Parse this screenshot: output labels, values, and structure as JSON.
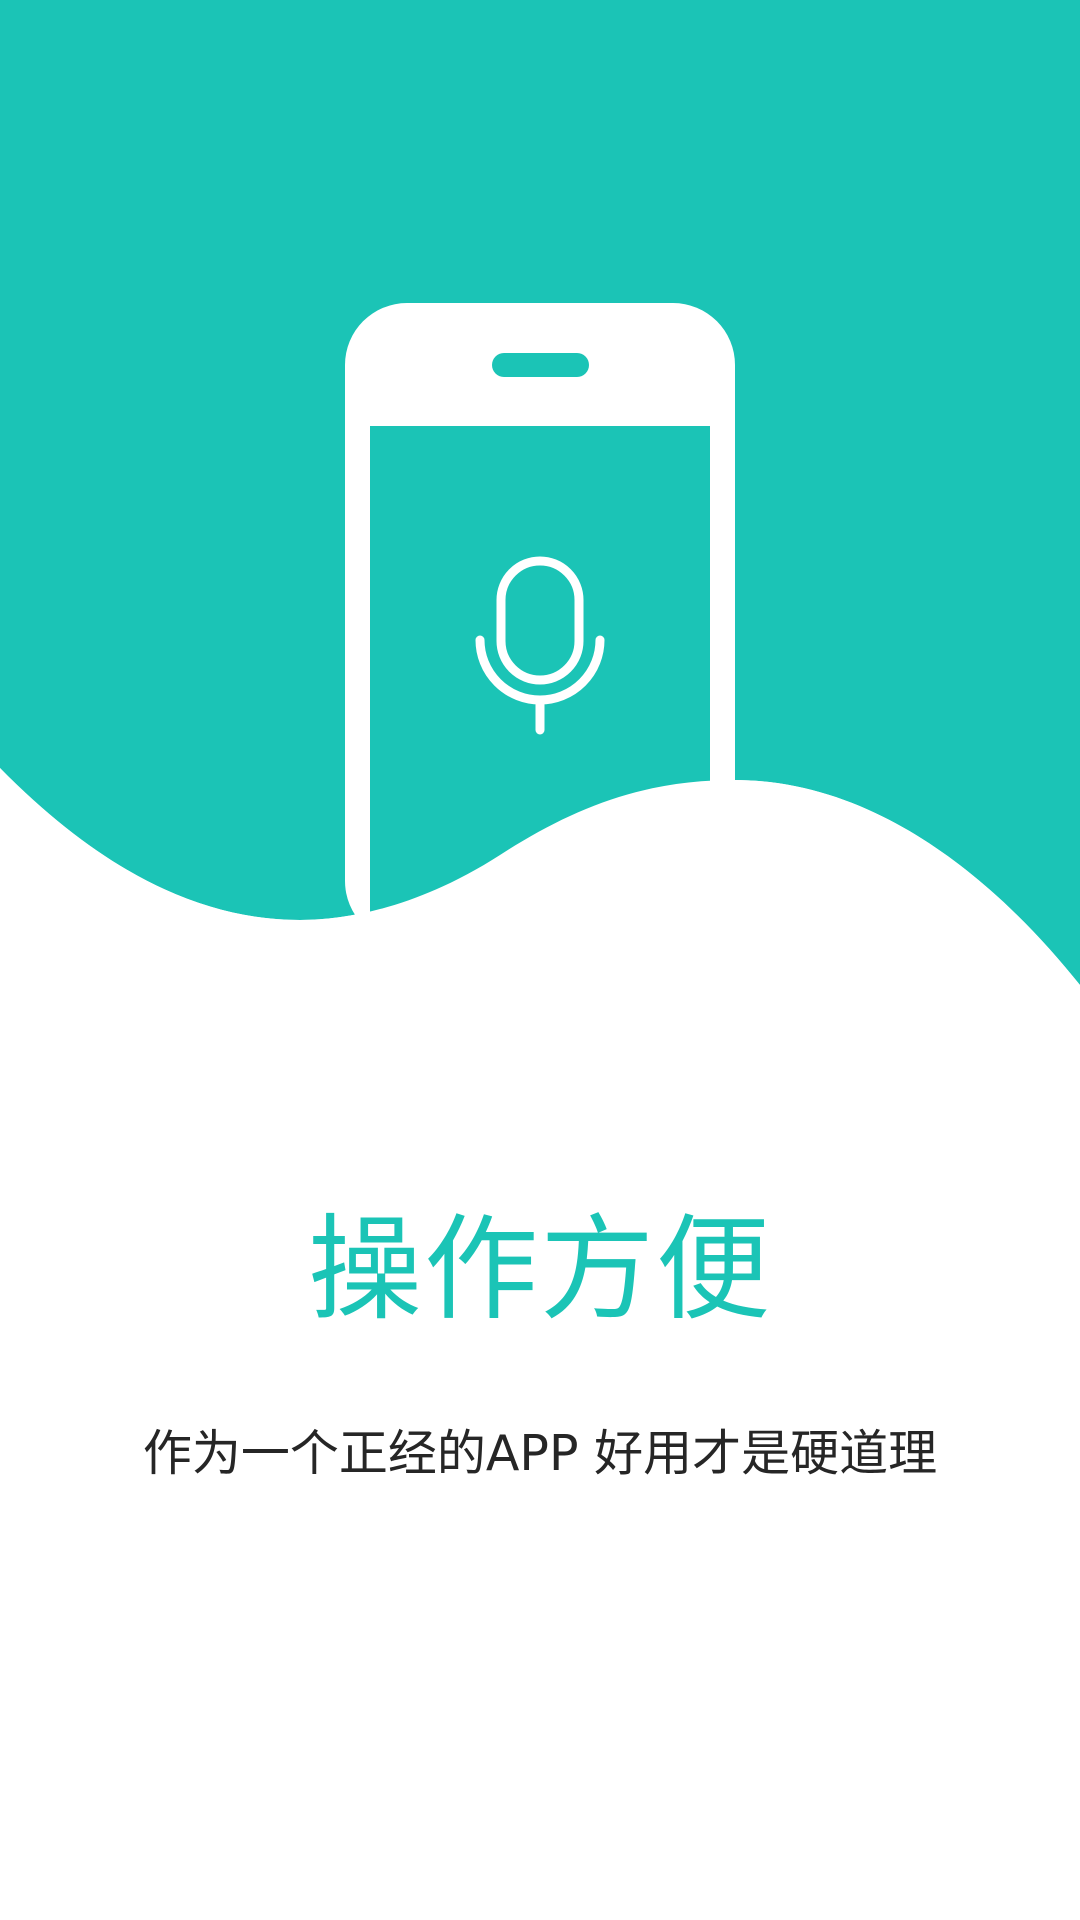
{
  "colors": {
    "accent": "#1BC4B6",
    "background": "#FFFFFF",
    "text": "#262626"
  },
  "illustration": {
    "icon_device": "smartphone-icon",
    "icon_screen": "microphone-icon"
  },
  "onboarding": {
    "title": "操作方便",
    "subtitle": "作为一个正经的APP 好用才是硬道理"
  }
}
